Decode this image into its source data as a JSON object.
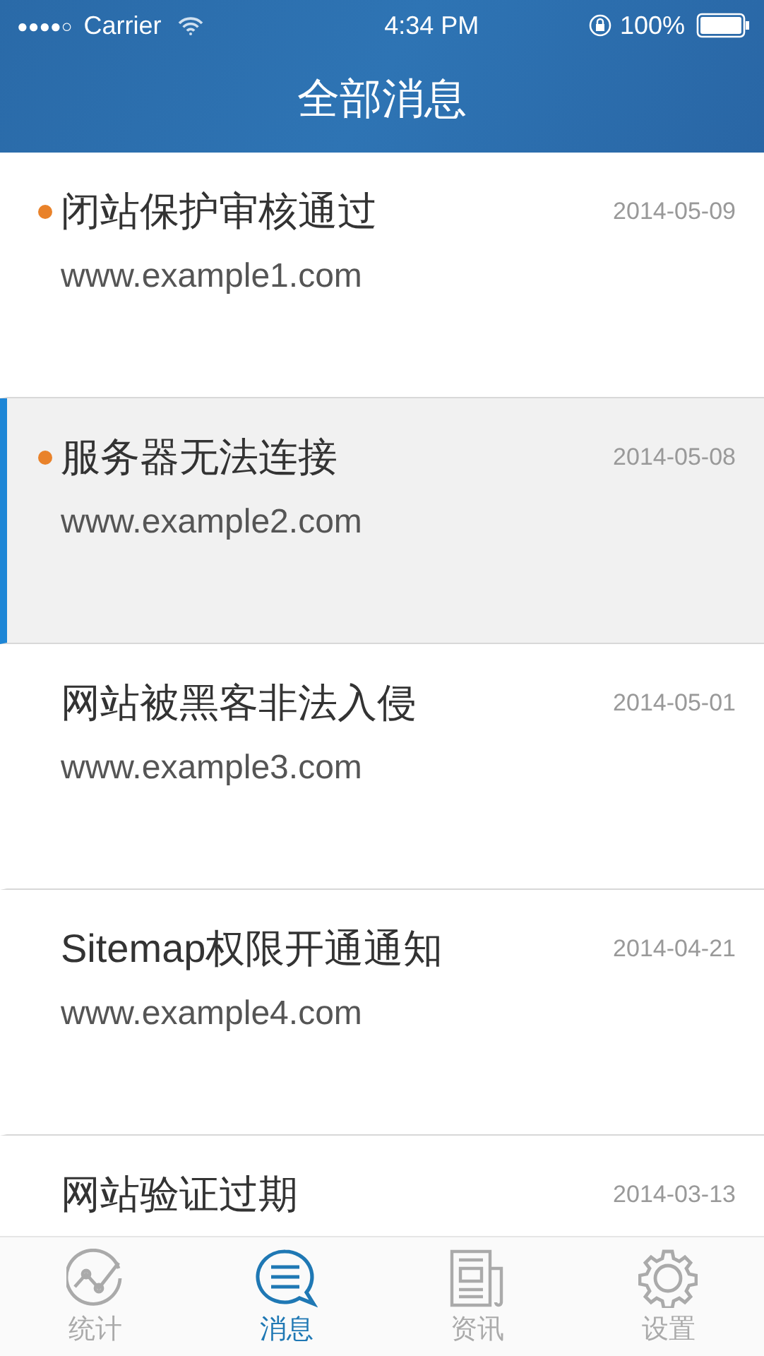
{
  "status_bar": {
    "signal_dots": "●●●●○",
    "carrier": "Carrier",
    "time": "4:34 PM",
    "battery": "100%"
  },
  "nav": {
    "title": "全部消息"
  },
  "messages": [
    {
      "title": "闭站保护审核通过",
      "url": "www.example1.com",
      "date": "2014-05-09",
      "unread": true,
      "selected": false
    },
    {
      "title": "服务器无法连接",
      "url": "www.example2.com",
      "date": "2014-05-08",
      "unread": true,
      "selected": true
    },
    {
      "title": "网站被黑客非法入侵",
      "url": "www.example3.com",
      "date": "2014-05-01",
      "unread": false,
      "selected": false
    },
    {
      "title": "Sitemap权限开通通知",
      "url": "www.example4.com",
      "date": "2014-04-21",
      "unread": false,
      "selected": false
    },
    {
      "title": "网站验证过期",
      "date": "2014-03-13",
      "unread": false,
      "selected": false
    }
  ],
  "tabs": [
    {
      "label": "统计",
      "kind": "stats",
      "selected": false
    },
    {
      "label": "消息",
      "kind": "messages",
      "selected": true
    },
    {
      "label": "资讯",
      "kind": "news",
      "selected": false
    },
    {
      "label": "设置",
      "kind": "settings",
      "selected": false
    }
  ]
}
